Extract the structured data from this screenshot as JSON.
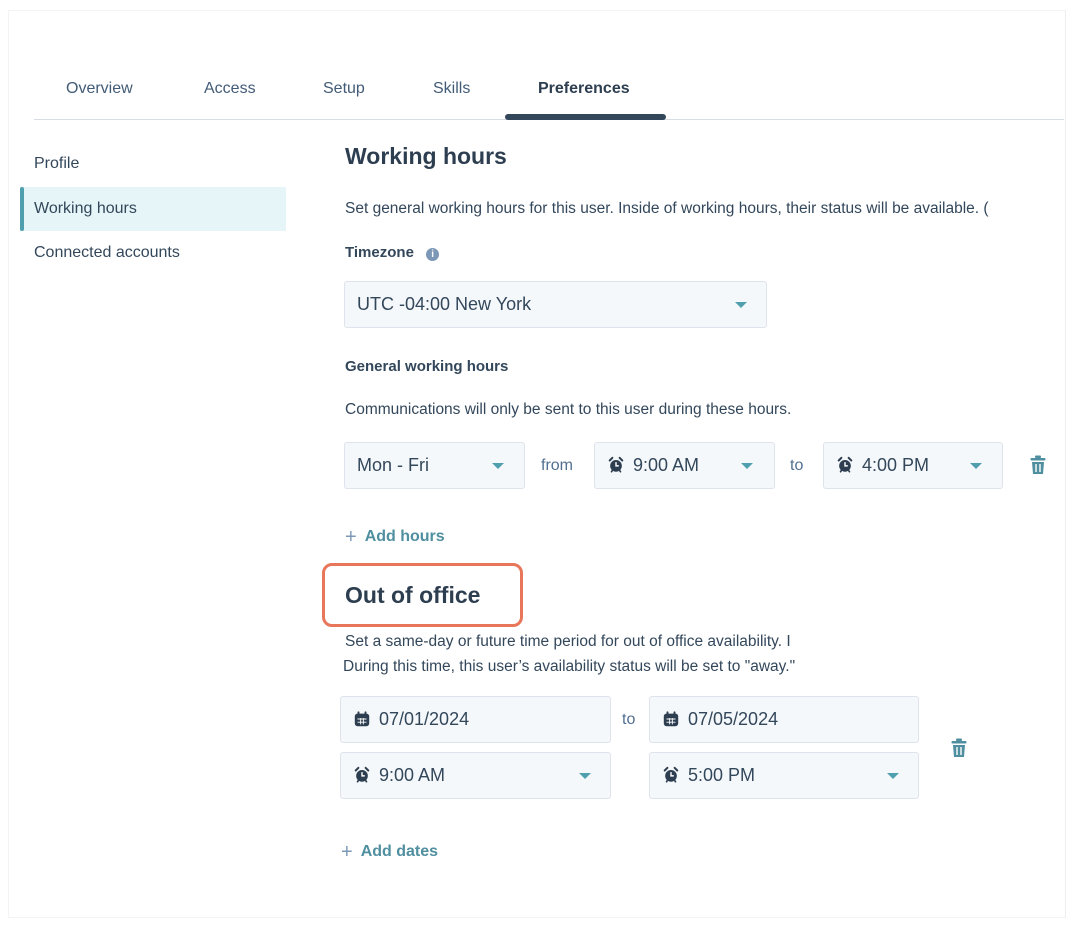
{
  "tabs": [
    {
      "label": "Overview",
      "active": false
    },
    {
      "label": "Access",
      "active": false
    },
    {
      "label": "Setup",
      "active": false
    },
    {
      "label": "Skills",
      "active": false
    },
    {
      "label": "Preferences",
      "active": true
    }
  ],
  "sidebar": {
    "items": [
      {
        "label": "Profile",
        "active": false
      },
      {
        "label": "Working hours",
        "active": true
      },
      {
        "label": "Connected accounts",
        "active": false
      }
    ]
  },
  "working_hours": {
    "title": "Working hours",
    "description": "Set general working hours for this user. Inside of working hours, their status will be available. (",
    "timezone_label": "Timezone",
    "timezone_info_icon": "info-icon",
    "timezone_value": "UTC -04:00 New York",
    "general_label": "General working hours",
    "general_description": "Communications will only be sent to this user during these hours.",
    "row": {
      "days": "Mon - Fri",
      "from_word": "from",
      "start_time": "9:00 AM",
      "to_word": "to",
      "end_time": "4:00 PM"
    },
    "add_hours_label": "Add hours"
  },
  "out_of_office": {
    "title": "Out of office",
    "description_line1": "Set a same-day or future time period for out of office availability. I",
    "description_line2": "During this time, this user’s availability status will be set to \"away.\"",
    "start_date": "07/01/2024",
    "to_word": "to",
    "end_date": "07/05/2024",
    "start_time": "9:00 AM",
    "end_time": "5:00 PM",
    "add_dates_label": "Add dates"
  },
  "colors": {
    "accent": "#4f9fae",
    "highlight": "#e8765a",
    "text": "#33475b",
    "input_bg": "#f5f8fa"
  }
}
